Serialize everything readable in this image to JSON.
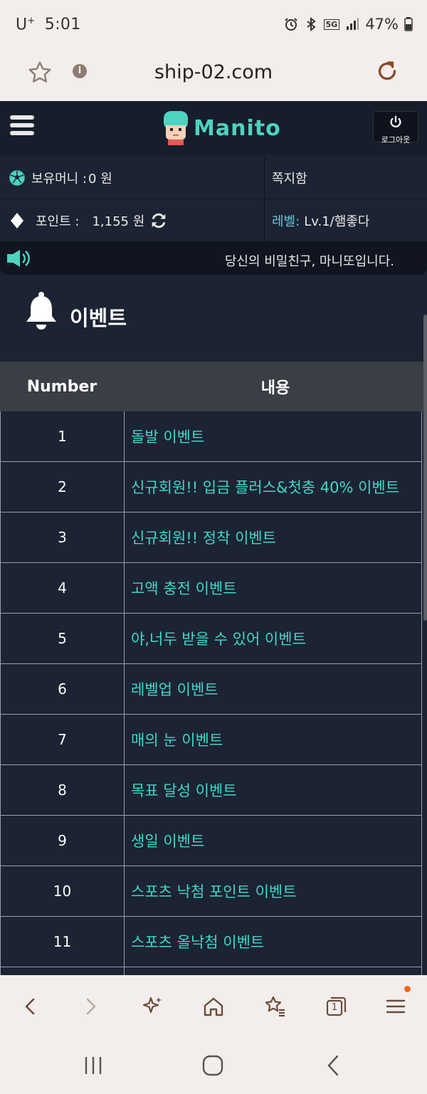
{
  "status_bar": {
    "carrier": "U",
    "carrier_sup": "+",
    "time": "5:01",
    "network": "5G",
    "battery": "47%"
  },
  "address_bar": {
    "url": "ship-02.com"
  },
  "header": {
    "logo_text": "Manito",
    "logout_label": "로그아웃"
  },
  "account": {
    "money_label": "보유머니 :",
    "money_value": "0 원",
    "messages_label": "쪽지함",
    "points_label": "포인트 :",
    "points_value": "1,155 원",
    "level_label": "레벨:",
    "level_value": "Lv.1/햄좋다"
  },
  "notice": {
    "message": "당신의 비밀친구, 마니또입니다."
  },
  "section": {
    "title": "이벤트"
  },
  "table": {
    "headers": [
      "Number",
      "내용"
    ],
    "rows": [
      {
        "number": "1",
        "title": "돌발 이벤트"
      },
      {
        "number": "2",
        "title": "신규회원!! 입금 플러스&첫충 40% 이벤트"
      },
      {
        "number": "3",
        "title": "신규회원!! 정착 이벤트"
      },
      {
        "number": "4",
        "title": "고액 충전 이벤트"
      },
      {
        "number": "5",
        "title": "야,너두 받을 수 있어 이벤트"
      },
      {
        "number": "6",
        "title": "레벨업 이벤트"
      },
      {
        "number": "7",
        "title": "매의 눈 이벤트"
      },
      {
        "number": "8",
        "title": "목표 달성 이벤트"
      },
      {
        "number": "9",
        "title": "생일 이벤트"
      },
      {
        "number": "10",
        "title": "스포츠 낙첨 포인트 이벤트"
      },
      {
        "number": "11",
        "title": "스포츠 올낙첨 이벤트"
      },
      {
        "number": "",
        "title": ""
      }
    ]
  },
  "browser_nav": {
    "tabs_count": "1"
  },
  "colors": {
    "accent": "#3ed8c8",
    "page_bg": "#1c2333",
    "header_bg": "#171d2b",
    "level_label": "#6ec1d8",
    "badge": "#f26a1b"
  }
}
